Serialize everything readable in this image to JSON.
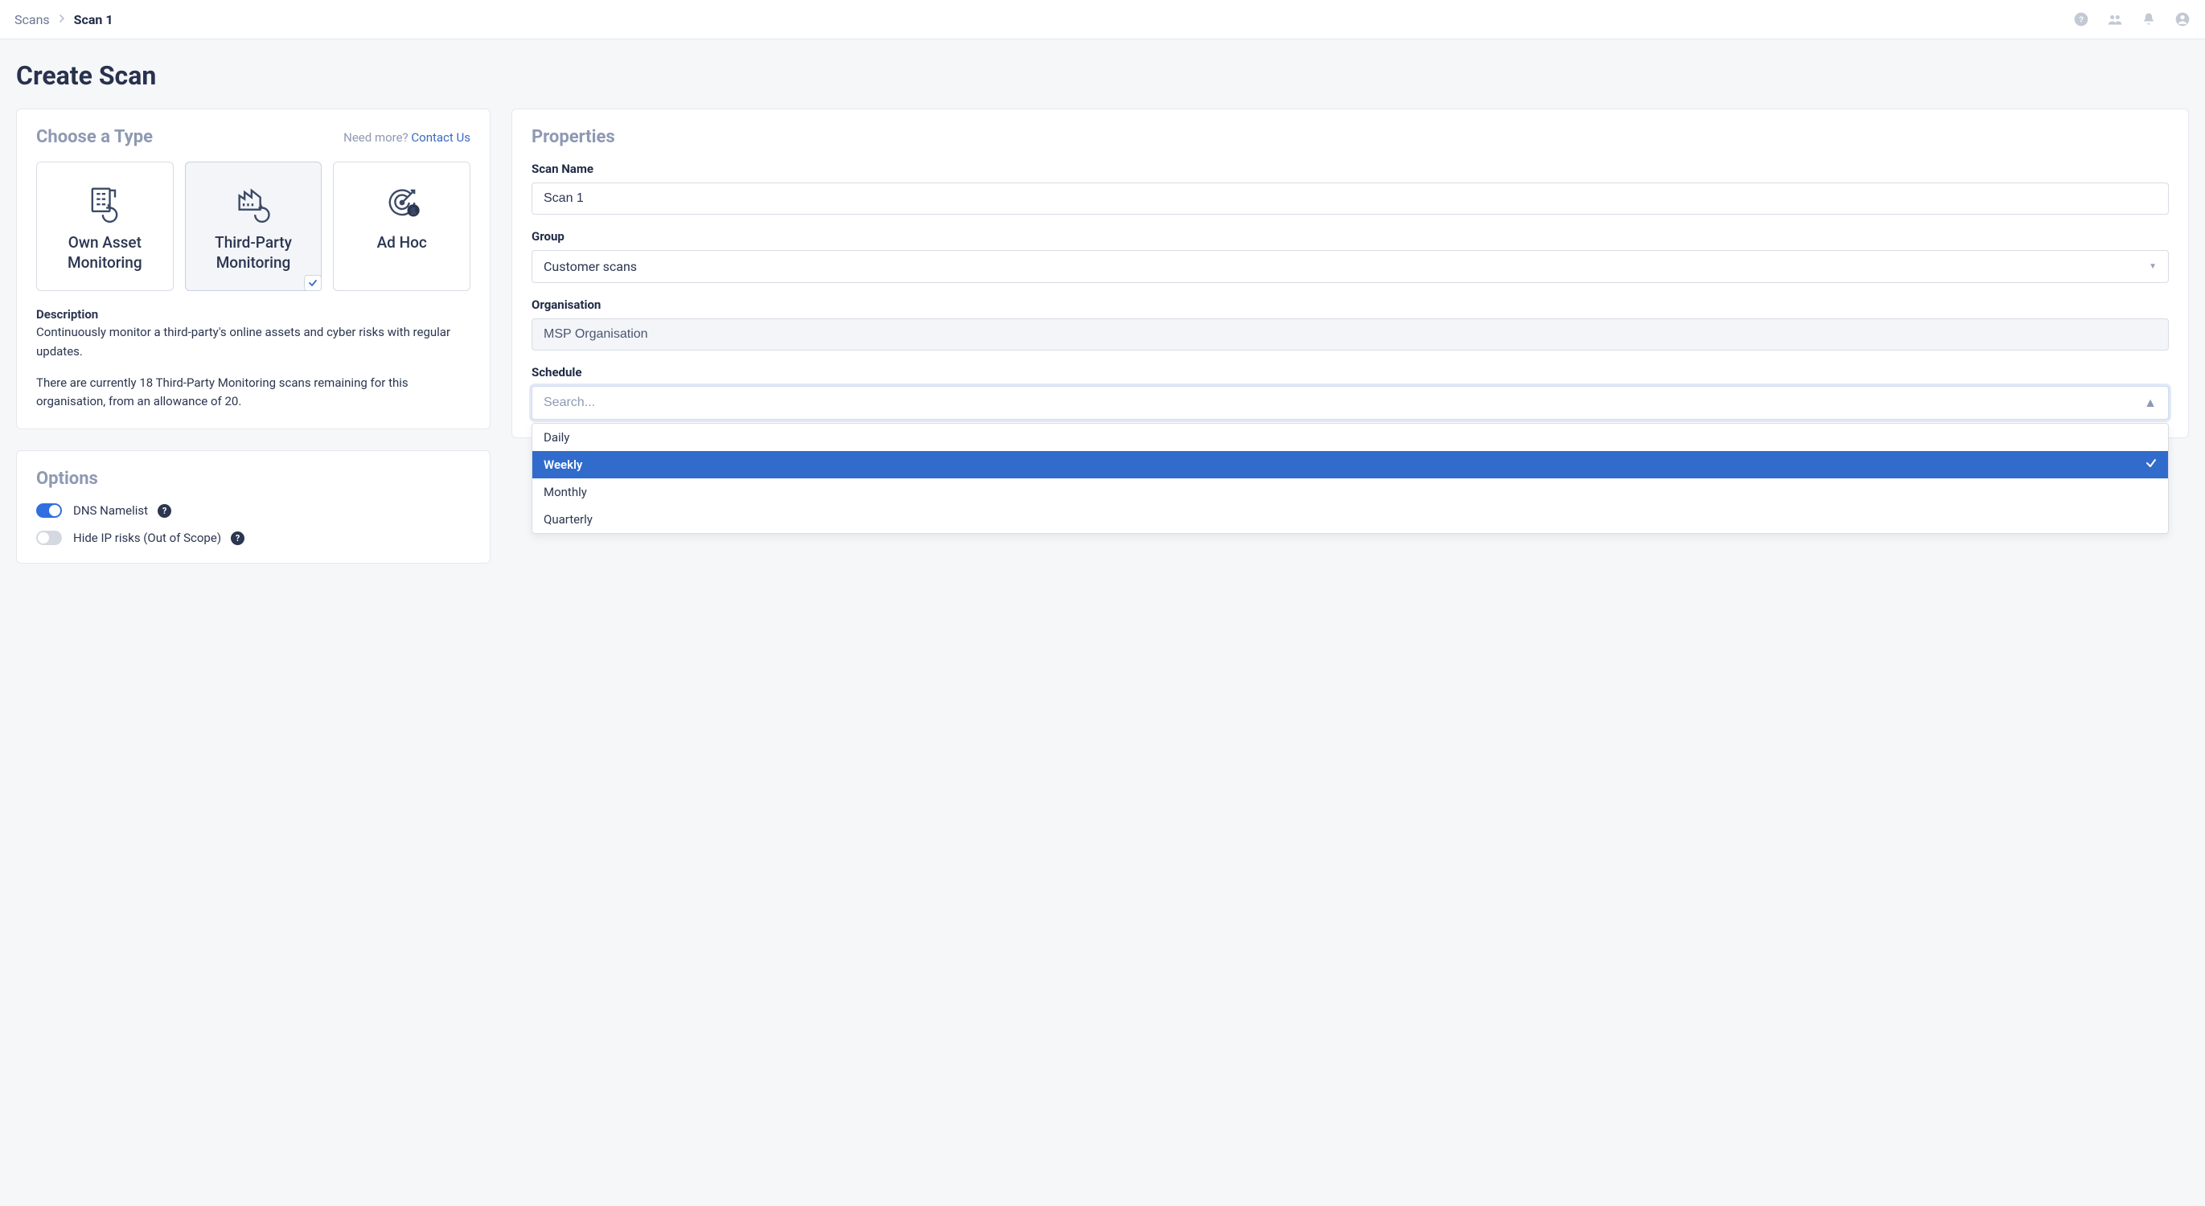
{
  "breadcrumb": {
    "parent": "Scans",
    "current": "Scan 1"
  },
  "page_title": "Create Scan",
  "choose_type": {
    "heading": "Choose a Type",
    "need_more_label": "Need more? ",
    "contact_link": "Contact Us",
    "cards": [
      {
        "label": "Own Asset Monitoring",
        "icon": "building-icon",
        "selected": false
      },
      {
        "label": "Third-Party Monitoring",
        "icon": "factory-icon",
        "selected": true
      },
      {
        "label": "Ad Hoc",
        "icon": "target-icon",
        "selected": false
      }
    ],
    "description_label": "Description",
    "description_text": "Continuously monitor a third-party's online assets and cyber risks with regular updates.",
    "remaining_text": "There are currently 18 Third-Party Monitoring scans remaining for this organisation, from an allowance of 20."
  },
  "options": {
    "heading": "Options",
    "items": [
      {
        "label": "DNS Namelist",
        "on": true
      },
      {
        "label": "Hide IP risks (Out of Scope)",
        "on": false
      }
    ]
  },
  "properties": {
    "heading": "Properties",
    "scan_name_label": "Scan Name",
    "scan_name_value": "Scan 1",
    "group_label": "Group",
    "group_value": "Customer scans",
    "organisation_label": "Organisation",
    "organisation_value": "MSP Organisation",
    "schedule_label": "Schedule",
    "schedule_placeholder": "Search...",
    "schedule_options": [
      {
        "label": "Daily",
        "selected": false
      },
      {
        "label": "Weekly",
        "selected": true
      },
      {
        "label": "Monthly",
        "selected": false
      },
      {
        "label": "Quarterly",
        "selected": false
      }
    ]
  }
}
